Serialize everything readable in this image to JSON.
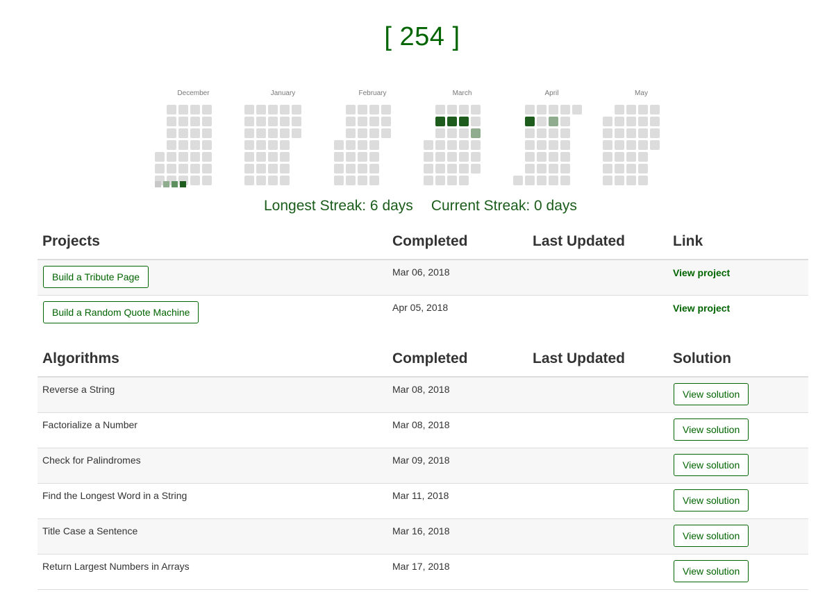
{
  "points": "[ 254 ]",
  "heatmap": {
    "months": [
      "December",
      "January",
      "February",
      "March",
      "April",
      "May"
    ],
    "colors": {
      "empty": "#dcdcdc",
      "level1": "#8fac8f",
      "level2": "#5e8f5e",
      "level3": "#1e5c1e"
    },
    "legend_levels": [
      "#c8c8c8",
      "#8fac8f",
      "#5e8f5e",
      "#1e5c1e"
    ],
    "active_cells": [
      {
        "month": 0,
        "week": 5,
        "weekday": 1,
        "level": 3
      },
      {
        "month": 3,
        "week": 1,
        "weekday": 1,
        "level": 3
      },
      {
        "month": 3,
        "week": 2,
        "weekday": 1,
        "level": 3
      },
      {
        "month": 3,
        "week": 3,
        "weekday": 1,
        "level": 3
      },
      {
        "month": 3,
        "week": 6,
        "weekday": 1,
        "level": 1
      },
      {
        "month": 3,
        "week": 4,
        "weekday": 2,
        "level": 1
      },
      {
        "month": 3,
        "week": 5,
        "weekday": 2,
        "level": 1
      },
      {
        "month": 3,
        "week": 5,
        "weekday": 4,
        "level": 3
      },
      {
        "month": 4,
        "week": 0,
        "weekday": 1,
        "level": 3
      },
      {
        "month": 4,
        "week": 1,
        "weekday": 1,
        "level": 3
      },
      {
        "month": 4,
        "week": 3,
        "weekday": 1,
        "level": 1
      },
      {
        "month": 4,
        "week": 6,
        "weekday": 0,
        "level": 2
      }
    ]
  },
  "streaks": {
    "longest": "Longest Streak: 6 days",
    "current": "Current Streak: 0 days"
  },
  "projects": {
    "headers": [
      "Projects",
      "Completed",
      "Last Updated",
      "Link"
    ],
    "rows": [
      {
        "name": "Build a Tribute Page",
        "completed": "Mar 06, 2018",
        "last_updated": "",
        "link": "View project"
      },
      {
        "name": "Build a Random Quote Machine",
        "completed": "Apr 05, 2018",
        "last_updated": "",
        "link": "View project"
      }
    ]
  },
  "algorithms": {
    "headers": [
      "Algorithms",
      "Completed",
      "Last Updated",
      "Solution"
    ],
    "rows": [
      {
        "name": "Reverse a String",
        "completed": "Mar 08, 2018",
        "last_updated": "",
        "solution": "View solution"
      },
      {
        "name": "Factorialize a Number",
        "completed": "Mar 08, 2018",
        "last_updated": "",
        "solution": "View solution"
      },
      {
        "name": "Check for Palindromes",
        "completed": "Mar 09, 2018",
        "last_updated": "",
        "solution": "View solution"
      },
      {
        "name": "Find the Longest Word in a String",
        "completed": "Mar 11, 2018",
        "last_updated": "",
        "solution": "View solution"
      },
      {
        "name": "Title Case a Sentence",
        "completed": "Mar 16, 2018",
        "last_updated": "",
        "solution": "View solution"
      },
      {
        "name": "Return Largest Numbers in Arrays",
        "completed": "Mar 17, 2018",
        "last_updated": "",
        "solution": "View solution"
      }
    ]
  }
}
